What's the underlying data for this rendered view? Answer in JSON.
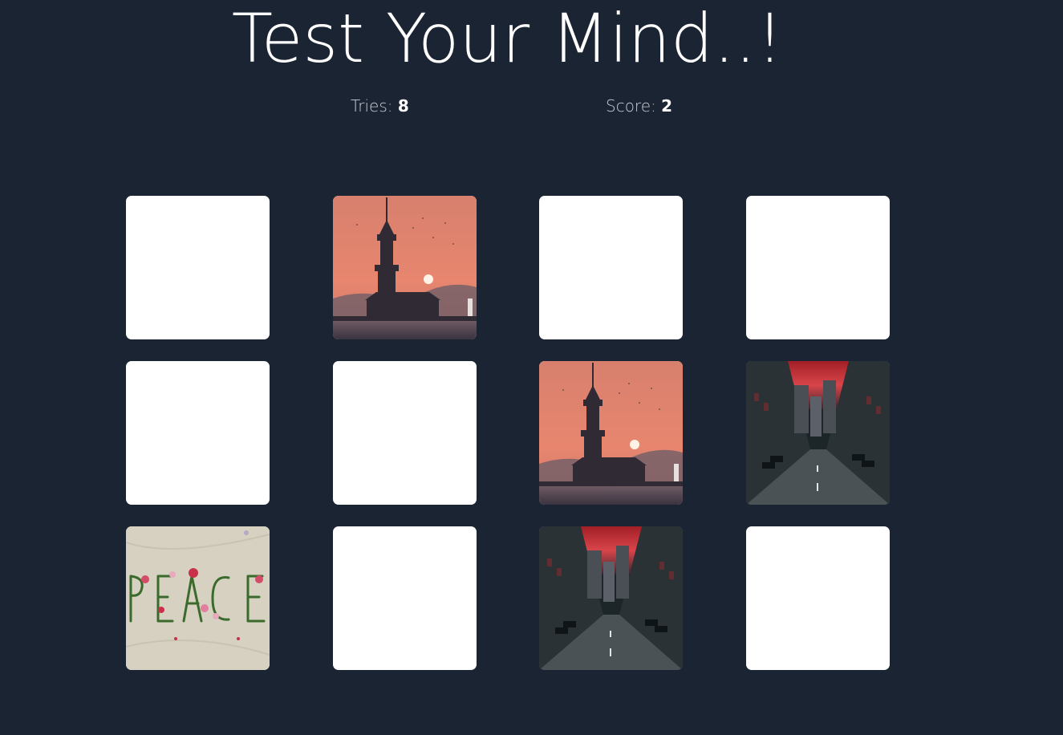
{
  "title": "Test Your Mind..!",
  "stats": {
    "tries_label": "Tries:",
    "tries_value": "8",
    "score_label": "Score:",
    "score_value": "2"
  },
  "board": {
    "rows": 3,
    "cols": 4,
    "cards": [
      {
        "state": "hidden",
        "image": null
      },
      {
        "state": "revealed",
        "image": "lighthouse-sunset"
      },
      {
        "state": "hidden",
        "image": null
      },
      {
        "state": "hidden",
        "image": null
      },
      {
        "state": "hidden",
        "image": null
      },
      {
        "state": "hidden",
        "image": null
      },
      {
        "state": "revealed",
        "image": "lighthouse-sunset"
      },
      {
        "state": "revealed",
        "image": "city-street"
      },
      {
        "state": "revealed",
        "image": "peace-flowers-sand"
      },
      {
        "state": "hidden",
        "image": null
      },
      {
        "state": "revealed",
        "image": "city-street"
      },
      {
        "state": "hidden",
        "image": null
      }
    ]
  },
  "colors": {
    "background": "#1b2433",
    "card_back": "#ffffff"
  }
}
